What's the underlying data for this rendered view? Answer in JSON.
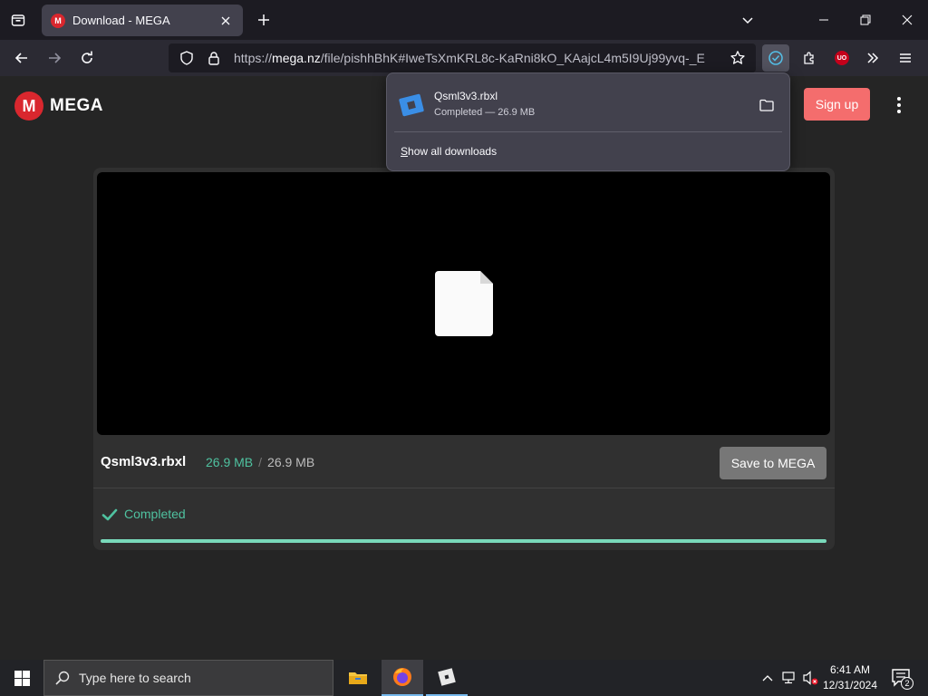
{
  "browser": {
    "tab_title": "Download - MEGA",
    "tab_favicon": "M",
    "url_prefix": "https://",
    "url_host": "mega.nz",
    "url_path": "/file/pishhBhK#IweTsXmKRL8c-KaRni8kO_KAajcL4m5I9Uj99yvq-_E",
    "ublock_label": "UO"
  },
  "downloads_panel": {
    "file_name": "Qsml3v3.rbxl",
    "status": "Completed — 26.9 MB",
    "show_all_prefix": "S",
    "show_all_rest": "how all downloads"
  },
  "mega": {
    "logo_letter": "M",
    "logo_text": "MEGA",
    "signup_label": "Sign up",
    "file_name": "Qsml3v3.rbxl",
    "downloaded": "26.9 MB",
    "separator": "/",
    "total": "26.9 MB",
    "save_label": "Save to MEGA",
    "status": "Completed",
    "progress_fraction": 1.0
  },
  "taskbar": {
    "search_placeholder": "Type here to search",
    "time": "6:41 AM",
    "date": "12/31/2024",
    "notification_count": "2"
  },
  "colors": {
    "mega_red": "#d9272e",
    "signup": "#f46d6d",
    "completed_green": "#4fc2a0"
  },
  "icons": [
    "tab-list-icon",
    "close-icon",
    "plus-icon",
    "chevron-down-icon",
    "minimize-icon",
    "restore-icon",
    "back-icon",
    "forward-icon",
    "reload-icon",
    "shield-icon",
    "lock-icon",
    "star-icon",
    "downloads-icon",
    "extensions-icon",
    "overflow-icon",
    "menu-icon",
    "file-icon",
    "folder-icon",
    "check-icon",
    "windows-icon",
    "search-icon",
    "file-explorer-icon",
    "firefox-icon",
    "roblox-icon",
    "chevron-up-icon",
    "network-icon",
    "volume-muted-icon",
    "notification-icon"
  ]
}
